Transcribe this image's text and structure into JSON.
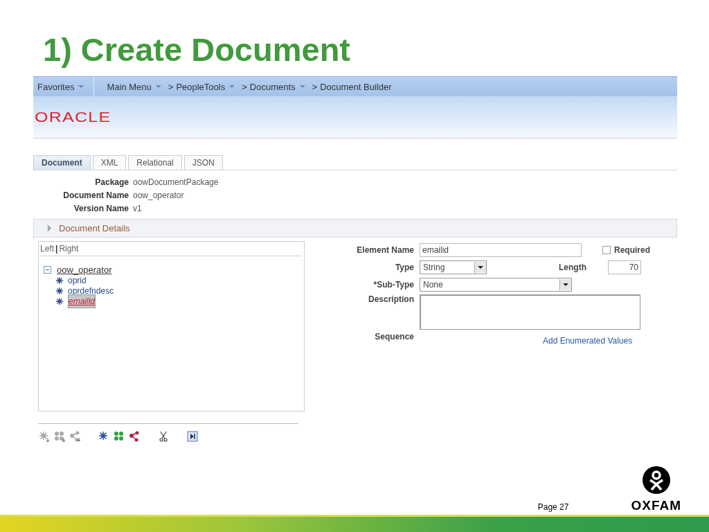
{
  "slide_title": "1) Create Document",
  "nav": {
    "favorites": {
      "label": "Favorites",
      "dropdown": true
    },
    "breadcrumbs": [
      {
        "label": "Main Menu",
        "dropdown": true
      },
      {
        "prefix": ">",
        "label": "PeopleTools",
        "dropdown": true
      },
      {
        "prefix": ">",
        "label": "Documents",
        "dropdown": true
      },
      {
        "prefix": ">",
        "label": "Document Builder",
        "dropdown": false
      }
    ]
  },
  "logo": "ORACLE",
  "tabs": [
    {
      "label": "Document",
      "selected": true
    },
    {
      "label": "XML",
      "selected": false
    },
    {
      "label": "Relational",
      "selected": false
    },
    {
      "label": "JSON",
      "selected": false
    }
  ],
  "info": [
    {
      "label": "Package",
      "value": "oowDocumentPackage"
    },
    {
      "label": "Document Name",
      "value": "oow_operator"
    },
    {
      "label": "Version Name",
      "value": "v1"
    }
  ],
  "details_section": {
    "label": "Document Details",
    "expanded": false
  },
  "tree_panel": {
    "links": [
      {
        "label": "Left",
        "active": false
      },
      {
        "label": "Right",
        "active": false
      }
    ],
    "divider": "|",
    "tree": {
      "label": "oow_operator",
      "expanded": true,
      "children": [
        {
          "label": "oprid",
          "selected": false
        },
        {
          "label": "oprdefndesc",
          "selected": false
        },
        {
          "label": "emailid",
          "selected": true
        }
      ]
    }
  },
  "form": {
    "element_name": {
      "label": "Element Name",
      "value": "emailid"
    },
    "required": {
      "label": "Required",
      "checked": false
    },
    "type": {
      "label": "Type",
      "value": "String"
    },
    "length": {
      "label": "Length",
      "value": "70"
    },
    "sub_type": {
      "label": "*Sub-Type",
      "value": "None"
    },
    "description": {
      "label": "Description"
    },
    "sequence": {
      "label": "Sequence"
    },
    "enum_link": "Add Enumerated Values"
  },
  "toolbar": [
    {
      "kind": "node",
      "disabled": true
    },
    {
      "kind": "group",
      "disabled": true
    },
    {
      "kind": "link",
      "disabled": true
    },
    {
      "kind": "node",
      "disabled": false
    },
    {
      "kind": "group",
      "disabled": false
    },
    {
      "kind": "link",
      "disabled": false
    },
    {
      "kind": "cut"
    },
    {
      "kind": "next"
    }
  ],
  "footer": {
    "page": "Page 27",
    "brand": "OXFAM"
  }
}
